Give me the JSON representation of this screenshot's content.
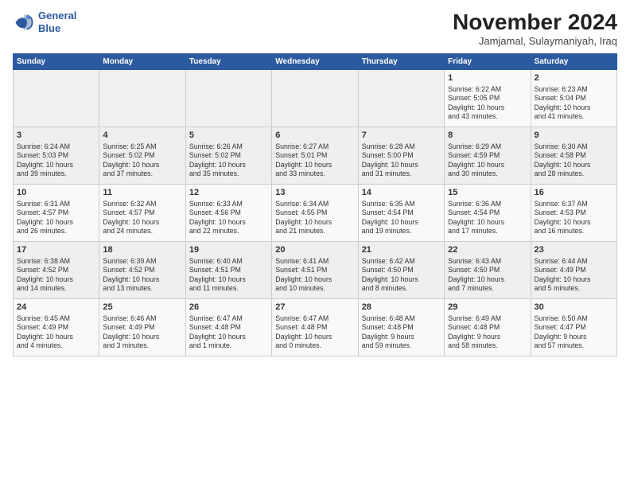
{
  "logo": {
    "line1": "General",
    "line2": "Blue"
  },
  "title": "November 2024",
  "subtitle": "Jamjamal, Sulaymaniyah, Iraq",
  "weekdays": [
    "Sunday",
    "Monday",
    "Tuesday",
    "Wednesday",
    "Thursday",
    "Friday",
    "Saturday"
  ],
  "weeks": [
    [
      {
        "day": "",
        "info": ""
      },
      {
        "day": "",
        "info": ""
      },
      {
        "day": "",
        "info": ""
      },
      {
        "day": "",
        "info": ""
      },
      {
        "day": "",
        "info": ""
      },
      {
        "day": "1",
        "info": "Sunrise: 6:22 AM\nSunset: 5:05 PM\nDaylight: 10 hours\nand 43 minutes."
      },
      {
        "day": "2",
        "info": "Sunrise: 6:23 AM\nSunset: 5:04 PM\nDaylight: 10 hours\nand 41 minutes."
      }
    ],
    [
      {
        "day": "3",
        "info": "Sunrise: 6:24 AM\nSunset: 5:03 PM\nDaylight: 10 hours\nand 39 minutes."
      },
      {
        "day": "4",
        "info": "Sunrise: 6:25 AM\nSunset: 5:02 PM\nDaylight: 10 hours\nand 37 minutes."
      },
      {
        "day": "5",
        "info": "Sunrise: 6:26 AM\nSunset: 5:02 PM\nDaylight: 10 hours\nand 35 minutes."
      },
      {
        "day": "6",
        "info": "Sunrise: 6:27 AM\nSunset: 5:01 PM\nDaylight: 10 hours\nand 33 minutes."
      },
      {
        "day": "7",
        "info": "Sunrise: 6:28 AM\nSunset: 5:00 PM\nDaylight: 10 hours\nand 31 minutes."
      },
      {
        "day": "8",
        "info": "Sunrise: 6:29 AM\nSunset: 4:59 PM\nDaylight: 10 hours\nand 30 minutes."
      },
      {
        "day": "9",
        "info": "Sunrise: 6:30 AM\nSunset: 4:58 PM\nDaylight: 10 hours\nand 28 minutes."
      }
    ],
    [
      {
        "day": "10",
        "info": "Sunrise: 6:31 AM\nSunset: 4:57 PM\nDaylight: 10 hours\nand 26 minutes."
      },
      {
        "day": "11",
        "info": "Sunrise: 6:32 AM\nSunset: 4:57 PM\nDaylight: 10 hours\nand 24 minutes."
      },
      {
        "day": "12",
        "info": "Sunrise: 6:33 AM\nSunset: 4:56 PM\nDaylight: 10 hours\nand 22 minutes."
      },
      {
        "day": "13",
        "info": "Sunrise: 6:34 AM\nSunset: 4:55 PM\nDaylight: 10 hours\nand 21 minutes."
      },
      {
        "day": "14",
        "info": "Sunrise: 6:35 AM\nSunset: 4:54 PM\nDaylight: 10 hours\nand 19 minutes."
      },
      {
        "day": "15",
        "info": "Sunrise: 6:36 AM\nSunset: 4:54 PM\nDaylight: 10 hours\nand 17 minutes."
      },
      {
        "day": "16",
        "info": "Sunrise: 6:37 AM\nSunset: 4:53 PM\nDaylight: 10 hours\nand 16 minutes."
      }
    ],
    [
      {
        "day": "17",
        "info": "Sunrise: 6:38 AM\nSunset: 4:52 PM\nDaylight: 10 hours\nand 14 minutes."
      },
      {
        "day": "18",
        "info": "Sunrise: 6:39 AM\nSunset: 4:52 PM\nDaylight: 10 hours\nand 13 minutes."
      },
      {
        "day": "19",
        "info": "Sunrise: 6:40 AM\nSunset: 4:51 PM\nDaylight: 10 hours\nand 11 minutes."
      },
      {
        "day": "20",
        "info": "Sunrise: 6:41 AM\nSunset: 4:51 PM\nDaylight: 10 hours\nand 10 minutes."
      },
      {
        "day": "21",
        "info": "Sunrise: 6:42 AM\nSunset: 4:50 PM\nDaylight: 10 hours\nand 8 minutes."
      },
      {
        "day": "22",
        "info": "Sunrise: 6:43 AM\nSunset: 4:50 PM\nDaylight: 10 hours\nand 7 minutes."
      },
      {
        "day": "23",
        "info": "Sunrise: 6:44 AM\nSunset: 4:49 PM\nDaylight: 10 hours\nand 5 minutes."
      }
    ],
    [
      {
        "day": "24",
        "info": "Sunrise: 6:45 AM\nSunset: 4:49 PM\nDaylight: 10 hours\nand 4 minutes."
      },
      {
        "day": "25",
        "info": "Sunrise: 6:46 AM\nSunset: 4:49 PM\nDaylight: 10 hours\nand 3 minutes."
      },
      {
        "day": "26",
        "info": "Sunrise: 6:47 AM\nSunset: 4:48 PM\nDaylight: 10 hours\nand 1 minute."
      },
      {
        "day": "27",
        "info": "Sunrise: 6:47 AM\nSunset: 4:48 PM\nDaylight: 10 hours\nand 0 minutes."
      },
      {
        "day": "28",
        "info": "Sunrise: 6:48 AM\nSunset: 4:48 PM\nDaylight: 9 hours\nand 59 minutes."
      },
      {
        "day": "29",
        "info": "Sunrise: 6:49 AM\nSunset: 4:48 PM\nDaylight: 9 hours\nand 58 minutes."
      },
      {
        "day": "30",
        "info": "Sunrise: 6:50 AM\nSunset: 4:47 PM\nDaylight: 9 hours\nand 57 minutes."
      }
    ]
  ]
}
